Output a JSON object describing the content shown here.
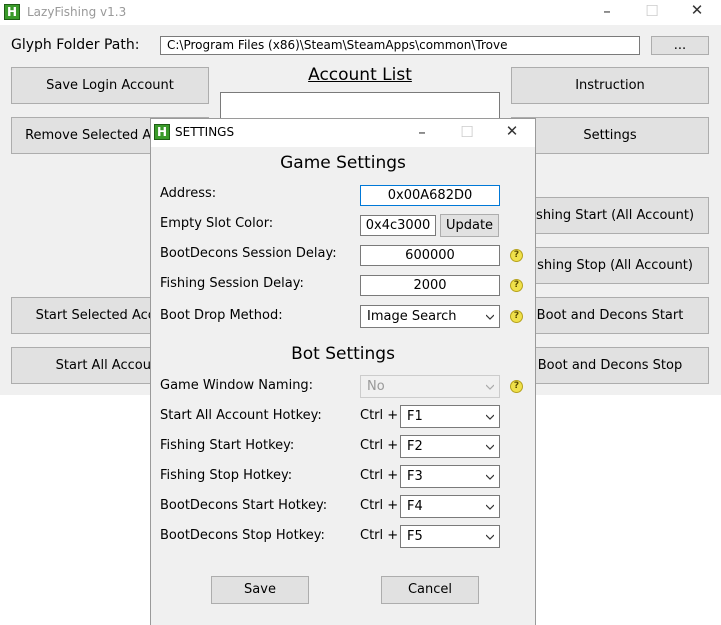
{
  "main": {
    "title": "LazyFishing v1.3",
    "glyph_label": "Glyph Folder Path:",
    "glyph_path": "C:\\Program Files (x86)\\Steam\\SteamApps\\common\\Trove",
    "browse_label": "...",
    "account_list_title": "Account List",
    "buttons": {
      "save_login": "Save Login Account",
      "remove_selected": "Remove Selected Account",
      "instruction": "Instruction",
      "settings": "Settings",
      "fishing_start_all": "Fishing Start (All Account)",
      "fishing_stop_all": "Fishing Stop (All Account)",
      "start_selected": "Start Selected Account",
      "start_all": "Start All Account",
      "boot_decons_start": "Boot and Decons Start",
      "boot_decons_stop": "Boot and Decons Stop"
    }
  },
  "settings": {
    "title": "SETTINGS",
    "game_header": "Game Settings",
    "address_label": "Address:",
    "address_value": "0x00A682D0",
    "empty_slot_label": "Empty Slot Color:",
    "empty_slot_value": "0x4c3000",
    "update_label": "Update",
    "bootdecons_delay_label": "BootDecons Session Delay:",
    "bootdecons_delay_value": "600000",
    "fishing_delay_label": "Fishing Session Delay:",
    "fishing_delay_value": "2000",
    "boot_drop_label": "Boot Drop Method:",
    "boot_drop_value": "Image Search",
    "bot_header": "Bot Settings",
    "window_naming_label": "Game Window Naming:",
    "window_naming_value": "No",
    "ctrl_prefix": "Ctrl +",
    "hotkeys": [
      {
        "label": "Start All Account Hotkey:",
        "key": "F1"
      },
      {
        "label": "Fishing Start Hotkey:",
        "key": "F2"
      },
      {
        "label": "Fishing Stop Hotkey:",
        "key": "F3"
      },
      {
        "label": "BootDecons Start Hotkey:",
        "key": "F4"
      },
      {
        "label": "BootDecons Stop Hotkey:",
        "key": "F5"
      }
    ],
    "save_label": "Save",
    "cancel_label": "Cancel",
    "help_glyph": "?"
  },
  "colors": {
    "window_bg": "#f0f0f0",
    "button_bg": "#e1e1e1",
    "app_icon": "#3a9a2a",
    "help_icon": "#efe04a"
  }
}
